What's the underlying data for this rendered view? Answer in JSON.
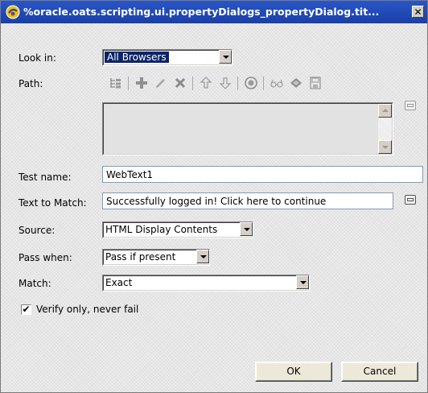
{
  "title": {
    "text": "%oracle.oats.scripting.ui.propertyDialogs_propertyDialog.tit..."
  },
  "look_in": {
    "label": "Look in:",
    "value": "All Browsers"
  },
  "path": {
    "label": "Path:"
  },
  "toolbar_icons": [
    "tree-icon",
    "add-icon",
    "edit-icon",
    "delete-icon",
    "move-up-icon",
    "move-down-icon",
    "target-icon",
    "glasses-icon",
    "capture-icon",
    "save-icon"
  ],
  "test_name": {
    "label": "Test name:",
    "value": "WebText1"
  },
  "text_to_match": {
    "label": "Text to Match:",
    "value": "Successfully logged in! Click here to continue"
  },
  "source": {
    "label": "Source:",
    "value": "HTML Display Contents"
  },
  "pass_when": {
    "label": "Pass when:",
    "value": "Pass if present"
  },
  "match": {
    "label": "Match:",
    "value": "Exact"
  },
  "verify_only": {
    "label": "Verify only, never fail",
    "checked": true,
    "mark": "✔"
  },
  "buttons": {
    "ok": "OK",
    "cancel": "Cancel"
  }
}
